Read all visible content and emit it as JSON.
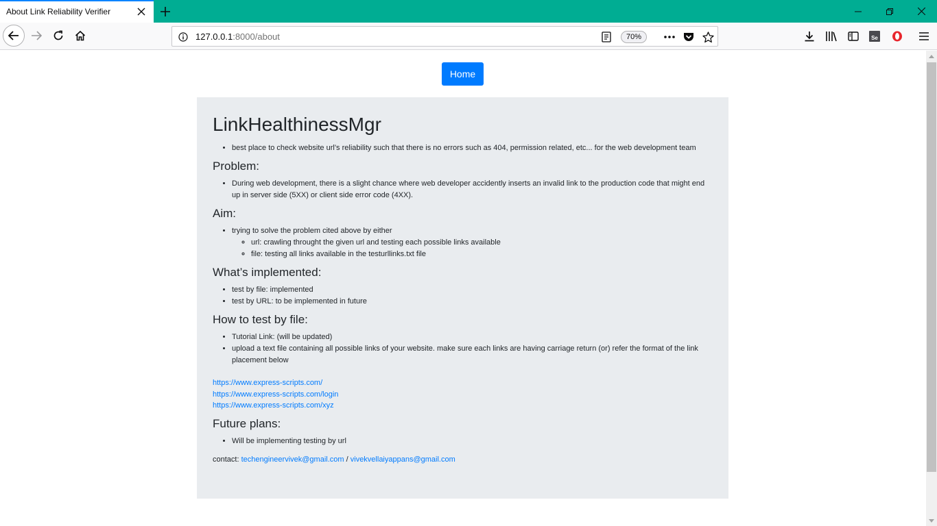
{
  "browser": {
    "tab_title": "About Link Reliability Verifier",
    "url_host": "127.0.0.1",
    "url_path": ":8000/about",
    "zoom": "70%"
  },
  "page": {
    "home_button": "Home",
    "title": "LinkHealthinessMgr",
    "intro_items": [
      "best place to check website url’s reliability such that there is no errors such as 404, permission related, etc... for the web development team"
    ],
    "problem": {
      "heading": "Problem:",
      "items": [
        "During web development, there is a slight chance where web developer accidently inserts an invalid link to the production code that might end up in server side (5XX) or client side error code (4XX)."
      ]
    },
    "aim": {
      "heading": "Aim:",
      "item": "trying to solve the problem cited above by either",
      "sub_items": [
        "url: crawling throught the given url and testing each possible links available",
        "file: testing all links available in the testurllinks.txt file"
      ]
    },
    "implemented": {
      "heading": "What’s implemented:",
      "items": [
        "test by file: implemented",
        "test by URL: to be implemented in future"
      ]
    },
    "howto": {
      "heading": "How to test by file:",
      "items": [
        "Tutorial Link: (will be updated)",
        "upload a text file containing all possible links of your website. make sure each links are having carriage return (or) refer the format of the link placement below"
      ]
    },
    "example_links": [
      "https://www.express-scripts.com/",
      "https://www.express-scripts.com/login",
      "https://www.express-scripts.com/xyz"
    ],
    "future": {
      "heading": "Future plans:",
      "items": [
        "Will be implementing testing by url"
      ]
    },
    "contact": {
      "label": "contact:",
      "email1": "techengineervivek@gmail.com",
      "separator": "/",
      "email2": "vivekvellaiyappans@gmail.com"
    }
  },
  "colors": {
    "titlebar": "#00ad93",
    "primary_button": "#007bff",
    "link": "#007bff",
    "jumbotron_bg": "#e9ecef"
  },
  "icons": [
    "close-icon",
    "plus-icon",
    "minimize-icon",
    "restore-icon",
    "back-icon",
    "forward-icon",
    "reload-icon",
    "home-icon",
    "info-icon",
    "reader-icon",
    "more-icon",
    "pocket-icon",
    "star-icon",
    "download-icon",
    "library-icon",
    "sidebar-icon",
    "selenium-icon",
    "opera-icon",
    "menu-icon"
  ]
}
